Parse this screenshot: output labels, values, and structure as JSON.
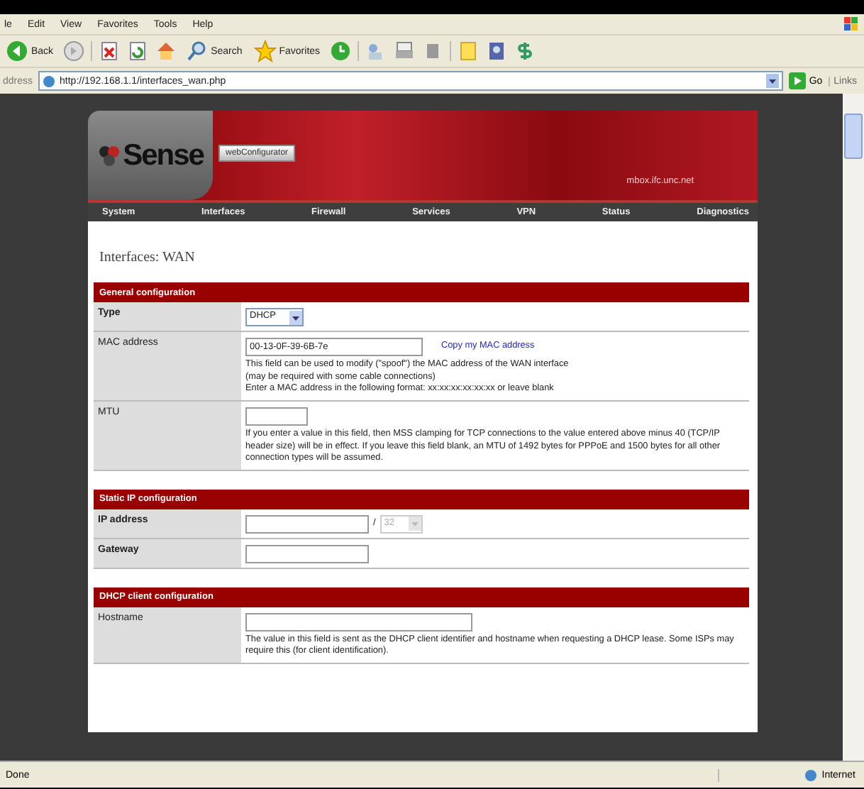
{
  "browser": {
    "menu": [
      "le",
      "Edit",
      "View",
      "Favorites",
      "Tools",
      "Help"
    ],
    "toolbar": {
      "back": "Back",
      "search": "Search",
      "favorites": "Favorites"
    },
    "address": {
      "label": "ddress",
      "url": "http://192.168.1.1/interfaces_wan.php",
      "go": "Go",
      "links": "Links"
    }
  },
  "page": {
    "logo": "Sense",
    "badge": "webConfigurator",
    "hostname": "mbox.ifc.unc.net",
    "nav": [
      "System",
      "Interfaces",
      "Firewall",
      "Services",
      "VPN",
      "Status",
      "Diagnostics"
    ],
    "title": "Interfaces: WAN",
    "sections": [
      {
        "title": "General configuration",
        "rows": [
          {
            "kind": "select",
            "label": "Type",
            "bold": true,
            "value": "DHCP"
          },
          {
            "kind": "mac",
            "label": "MAC address",
            "bold": false,
            "value": "00-13-0F-39-6B-7e",
            "link": "Copy my MAC address",
            "help": [
              "This field can be used to modify (\"spoof\") the MAC address of the WAN interface",
              "(may be required with some cable connections)",
              "Enter a MAC address in the following format: xx:xx:xx:xx:xx:xx or leave blank"
            ]
          },
          {
            "kind": "short",
            "label": "MTU",
            "bold": false,
            "help": [
              "If you enter a value in this field, then MSS clamping for TCP connections to the value entered above minus 40 (TCP/IP header size) will be in effect. If you leave this field blank, an MTU of 1492 bytes for PPPoE and 1500 bytes for all other connection types will be assumed."
            ]
          }
        ]
      },
      {
        "title": "Static IP configuration",
        "rows": [
          {
            "kind": "ip",
            "label": "IP address",
            "bold": true,
            "separator": "/",
            "mask": "32",
            "mask_disabled": true
          },
          {
            "kind": "medium",
            "label": "Gateway",
            "bold": true
          }
        ]
      },
      {
        "title": "DHCP client configuration",
        "rows": [
          {
            "kind": "long",
            "label": "Hostname",
            "bold": false,
            "help": [
              "The value in this field is sent as the DHCP client identifier and hostname when requesting a DHCP lease. Some ISPs may require this (for client identification)."
            ]
          }
        ]
      }
    ]
  },
  "status_bar": {
    "text": "Done",
    "zone": "Internet"
  }
}
